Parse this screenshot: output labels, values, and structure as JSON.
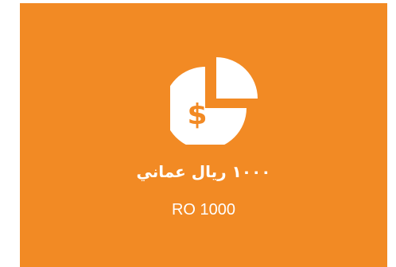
{
  "card": {
    "background_color": "#f28a24",
    "icon": "pie-chart-dollar-icon",
    "amount_ar": "١٠٠٠ ريال عماني",
    "amount_en": "RO 1000"
  }
}
